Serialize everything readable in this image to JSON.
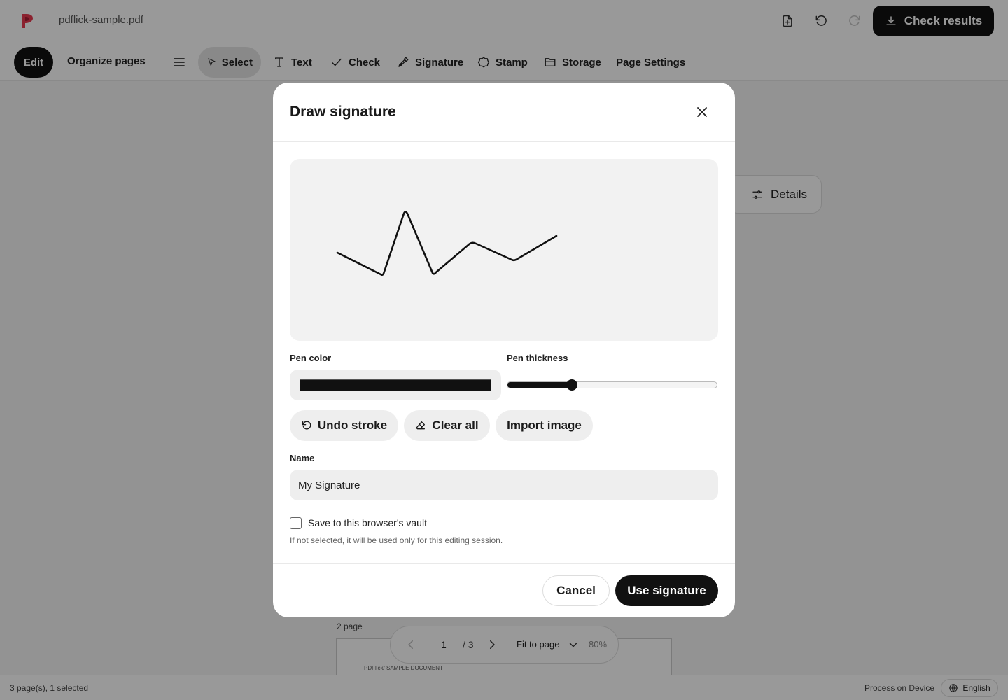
{
  "app": {
    "filename": "pdflick-sample.pdf",
    "brand_color": "#e8394f",
    "check_results_label": "Check results"
  },
  "toolbar": {
    "modes": [
      "Edit",
      "Organize pages"
    ],
    "tools": [
      {
        "label": "Select",
        "icon": "cursor-icon",
        "active": true
      },
      {
        "label": "Text",
        "icon": "text-icon"
      },
      {
        "label": "Check",
        "icon": "check-icon"
      },
      {
        "label": "Signature",
        "icon": "pen-icon"
      },
      {
        "label": "Stamp",
        "icon": "stamp-icon"
      },
      {
        "label": "Storage",
        "icon": "folder-icon"
      },
      {
        "label": "Page Settings",
        "icon": ""
      }
    ]
  },
  "workspace": {
    "details_label": "Details",
    "page_label": "2 page",
    "page_header_text": "PDFlick/ SAMPLE DOCUMENT"
  },
  "pager": {
    "current": "1",
    "total": "/ 3",
    "fit_label": "Fit to page",
    "zoom": "80%"
  },
  "status": {
    "pages_info": "3 page(s), 1 selected",
    "process_label": "Process on Device",
    "language": "English"
  },
  "modal": {
    "title": "Draw signature",
    "pen_color_label": "Pen color",
    "pen_color": "#111111",
    "pen_thickness_label": "Pen thickness",
    "pen_thickness_fraction": 0.31,
    "undo_label": "Undo stroke",
    "clear_label": "Clear all",
    "import_label": "Import image",
    "name_label": "Name",
    "name_value": "My Signature",
    "save_vault_label": "Save to this browser's vault",
    "save_vault_checked": false,
    "hint": "If not selected, it will be used only for this editing session.",
    "cancel_label": "Cancel",
    "use_label": "Use signature"
  }
}
